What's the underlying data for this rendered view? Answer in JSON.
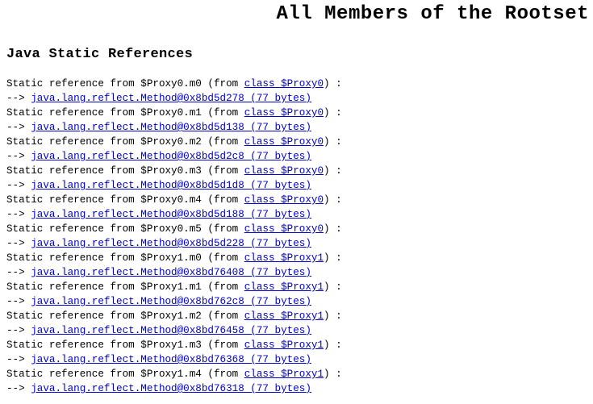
{
  "page": {
    "title": "All Members of the Rootset",
    "section_heading": "Java Static References"
  },
  "labels": {
    "prefix": "Static reference from ",
    "from_open": " (from ",
    "from_close": ")",
    "colon": " :",
    "arrow": "--> "
  },
  "references": [
    {
      "source": "$Proxy0.m0",
      "class_link": "class $Proxy0",
      "target_link": "java.lang.reflect.Method@0x8bd5d278 (77 bytes)"
    },
    {
      "source": "$Proxy0.m1",
      "class_link": "class $Proxy0",
      "target_link": "java.lang.reflect.Method@0x8bd5d138 (77 bytes)"
    },
    {
      "source": "$Proxy0.m2",
      "class_link": "class $Proxy0",
      "target_link": "java.lang.reflect.Method@0x8bd5d2c8 (77 bytes)"
    },
    {
      "source": "$Proxy0.m3",
      "class_link": "class $Proxy0",
      "target_link": "java.lang.reflect.Method@0x8bd5d1d8 (77 bytes)"
    },
    {
      "source": "$Proxy0.m4",
      "class_link": "class $Proxy0",
      "target_link": "java.lang.reflect.Method@0x8bd5d188 (77 bytes)"
    },
    {
      "source": "$Proxy0.m5",
      "class_link": "class $Proxy0",
      "target_link": "java.lang.reflect.Method@0x8bd5d228 (77 bytes)"
    },
    {
      "source": "$Proxy1.m0",
      "class_link": "class $Proxy1",
      "target_link": "java.lang.reflect.Method@0x8bd76408 (77 bytes)"
    },
    {
      "source": "$Proxy1.m1",
      "class_link": "class $Proxy1",
      "target_link": "java.lang.reflect.Method@0x8bd762c8 (77 bytes)"
    },
    {
      "source": "$Proxy1.m2",
      "class_link": "class $Proxy1",
      "target_link": "java.lang.reflect.Method@0x8bd76458 (77 bytes)"
    },
    {
      "source": "$Proxy1.m3",
      "class_link": "class $Proxy1",
      "target_link": "java.lang.reflect.Method@0x8bd76368 (77 bytes)"
    },
    {
      "source": "$Proxy1.m4",
      "class_link": "class $Proxy1",
      "target_link": "java.lang.reflect.Method@0x8bd76318 (77 bytes)"
    }
  ],
  "colors": {
    "link": "#0000c8",
    "text": "#000000",
    "background": "#ffffff"
  }
}
